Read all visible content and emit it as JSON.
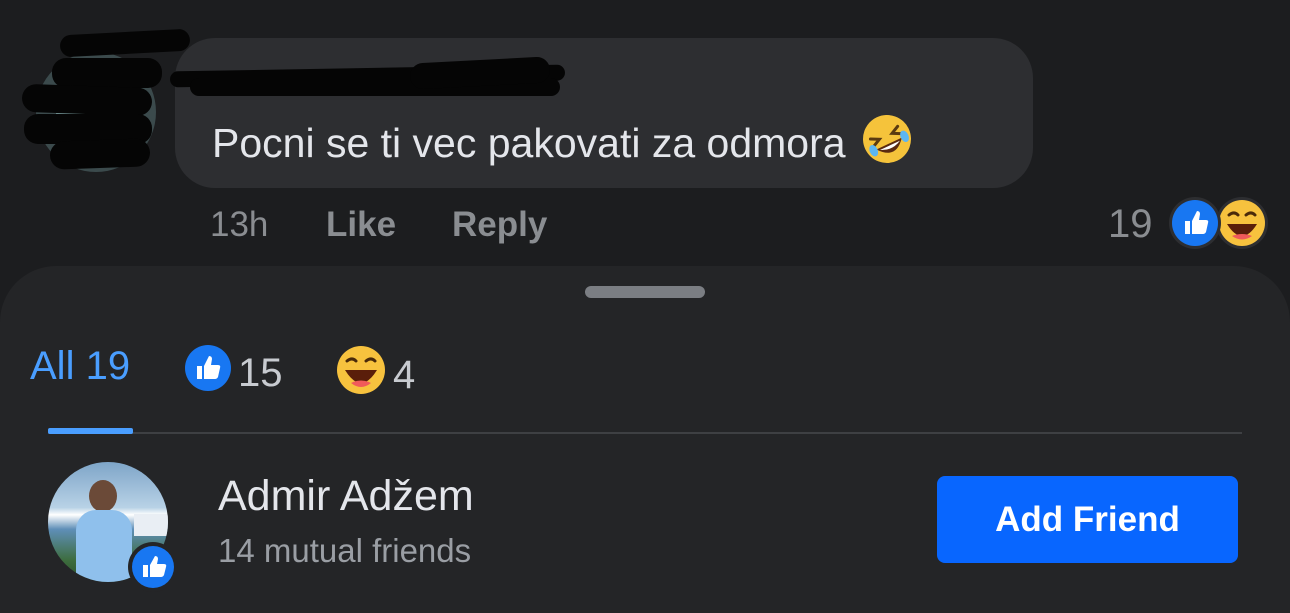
{
  "comment": {
    "text": "Pocni se ti vec pakovati za odmora",
    "emoji_icon": "rofl-emoji-icon",
    "time": "13h",
    "like_label": "Like",
    "reply_label": "Reply",
    "reaction_count": "19",
    "reaction_icons": [
      "like-reaction-icon",
      "haha-reaction-icon"
    ]
  },
  "reactions_sheet": {
    "tabs": [
      {
        "label": "All 19",
        "icon": null,
        "selected": true
      },
      {
        "label": "15",
        "icon": "like-reaction-icon",
        "selected": false
      },
      {
        "label": "4",
        "icon": "haha-reaction-icon",
        "selected": false
      }
    ],
    "users": [
      {
        "name": "Admir Adžem",
        "mutual": "14 mutual friends",
        "reaction_icon": "like-reaction-icon",
        "action_label": "Add Friend"
      }
    ]
  },
  "colors": {
    "accent": "#4a9eff",
    "button": "#0866ff",
    "background": "#1c1d1f",
    "sheet": "#242527",
    "bubble": "#2d2e31"
  }
}
